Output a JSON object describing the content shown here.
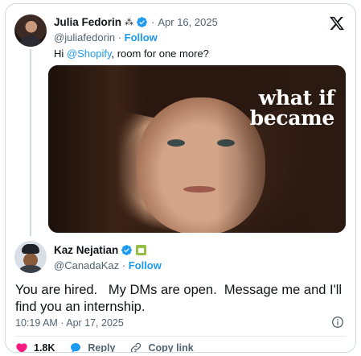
{
  "quoted_tweet": {
    "name": "Julia Fedorin",
    "name_emoji": "⁂",
    "separator": "·",
    "date": "Apr 16, 2025",
    "handle": "@juliafedorin",
    "handle_separator": " · ",
    "follow_label": "Follow",
    "text_prefix": "Hi ",
    "mention": "@Shopify",
    "text_suffix": ", room for one more?",
    "media_overlay_line1": "what if",
    "media_overlay_line2": "became"
  },
  "main_tweet": {
    "name": "Kaz Nejatian",
    "handle": "@CanadaKaz",
    "handle_separator": " · ",
    "follow_label": "Follow",
    "text_line1": "You are hired.   My DMs are open.  Message me and I'll",
    "text_line2": "find you an internship.",
    "timestamp": "10:19 AM · Apr 17, 2025"
  },
  "actions": {
    "like_count": "1.8K",
    "reply_label": "Reply",
    "copy_link_label": "Copy link"
  },
  "colors": {
    "accent": "#1d9bf0",
    "like": "#f91880",
    "verified": "#1d9bf0",
    "shop_badge": "#95bf47"
  },
  "icons": [
    "x-logo-icon",
    "verified-icon",
    "shopify-badge-icon",
    "info-icon",
    "heart-icon",
    "reply-bubble-icon",
    "link-icon"
  ]
}
